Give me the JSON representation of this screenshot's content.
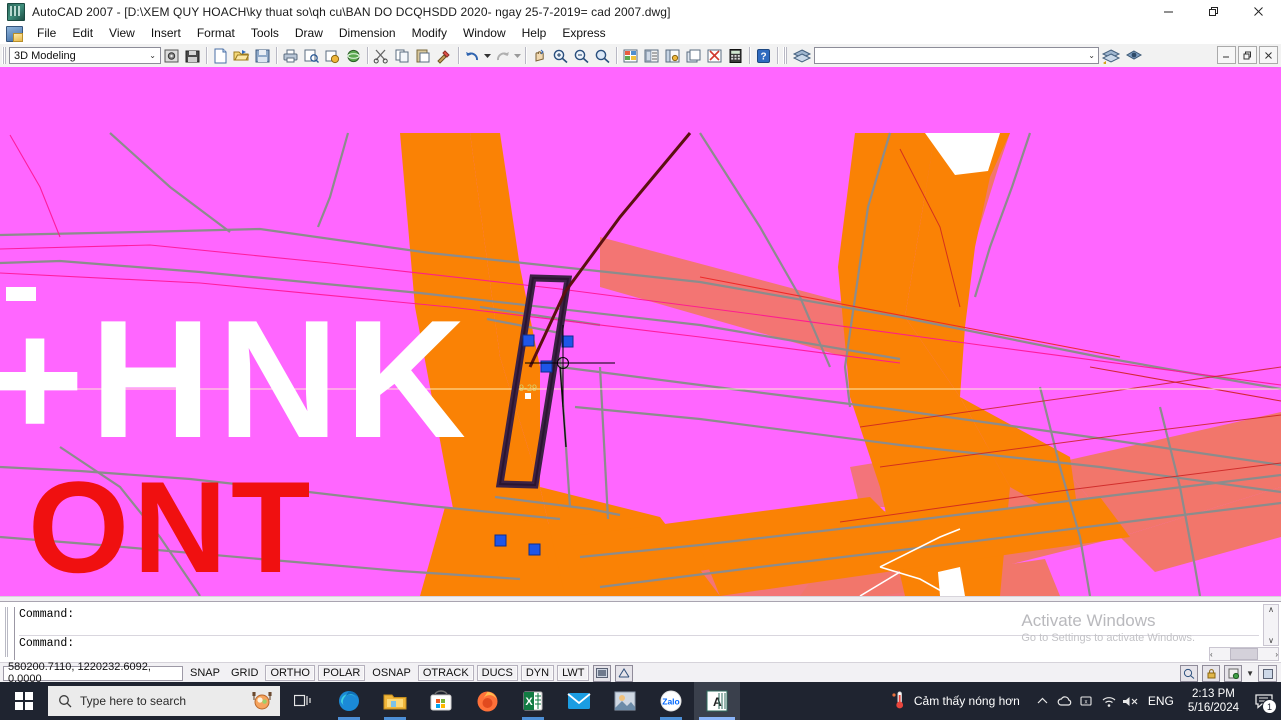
{
  "window": {
    "title": "AutoCAD 2007 - [D:\\XEM QUY HOACH\\ky thuat so\\qh cu\\BAN DO DCQHSDD 2020- ngay 25-7-2019= cad 2007.dwg]",
    "app_icon": "autocad-icon",
    "minimize": "—",
    "restore": "❐",
    "close": "✕",
    "doc_minimize": "—",
    "doc_restore": "❐",
    "doc_close": "✕"
  },
  "menu": {
    "items": [
      {
        "label": "File"
      },
      {
        "label": "Edit"
      },
      {
        "label": "View"
      },
      {
        "label": "Insert"
      },
      {
        "label": "Format"
      },
      {
        "label": "Tools"
      },
      {
        "label": "Draw"
      },
      {
        "label": "Dimension"
      },
      {
        "label": "Modify"
      },
      {
        "label": "Window"
      },
      {
        "label": "Help"
      },
      {
        "label": "Express"
      }
    ]
  },
  "toolbar": {
    "workspace_value": "3D Modeling",
    "workspace_chevron": "⌄",
    "layer_value": "",
    "layer_chevron": "⌄",
    "buttons": [
      {
        "name": "workspace-settings-icon",
        "tip": "Workspace Settings"
      },
      {
        "name": "workspace-save-icon",
        "tip": "Save Workspace"
      },
      {
        "name": "new-icon",
        "tip": "QNew"
      },
      {
        "name": "open-icon",
        "tip": "Open"
      },
      {
        "name": "save-icon",
        "tip": "Save"
      },
      {
        "name": "plot-icon",
        "tip": "Plot"
      },
      {
        "name": "plot-preview-icon",
        "tip": "Plot Preview"
      },
      {
        "name": "publish-icon",
        "tip": "Publish"
      },
      {
        "name": "3dorbit-icon",
        "tip": "3D Orbit"
      },
      {
        "name": "cut-icon",
        "tip": "Cut"
      },
      {
        "name": "copy-icon",
        "tip": "Copy"
      },
      {
        "name": "paste-icon",
        "tip": "Paste"
      },
      {
        "name": "match-properties-icon",
        "tip": "Match Properties"
      },
      {
        "name": "undo-icon",
        "tip": "Undo"
      },
      {
        "name": "redo-icon",
        "tip": "Redo"
      },
      {
        "name": "pan-icon",
        "tip": "Pan Realtime"
      },
      {
        "name": "zoom-realtime-icon",
        "tip": "Zoom Realtime"
      },
      {
        "name": "zoom-window-icon",
        "tip": "Zoom Window"
      },
      {
        "name": "zoom-previous-icon",
        "tip": "Zoom Previous"
      },
      {
        "name": "properties-icon",
        "tip": "Properties"
      },
      {
        "name": "designcenter-icon",
        "tip": "DesignCenter"
      },
      {
        "name": "tool-palettes-icon",
        "tip": "Tool Palettes"
      },
      {
        "name": "sheet-set-icon",
        "tip": "Sheet Set Manager"
      },
      {
        "name": "markup-set-icon",
        "tip": "Markup Set Manager"
      },
      {
        "name": "quickcalc-icon",
        "tip": "QuickCalc"
      },
      {
        "name": "help-icon",
        "tip": "Help"
      },
      {
        "name": "layer-manager-icon",
        "tip": "Layer Properties Manager"
      },
      {
        "name": "layer-previous-icon",
        "tip": "Layer Previous"
      },
      {
        "name": "layer-state-icon",
        "tip": "Layer States"
      }
    ]
  },
  "drawing": {
    "labels": [
      {
        "text": "+HNK",
        "color": "#ffffff"
      },
      {
        "text": "ONT",
        "color": "#f01010"
      },
      {
        "text": "9-29",
        "color": "#d9d06a"
      }
    ],
    "colors": {
      "background": "#ff66ff",
      "road": "#fa8205",
      "parcel": "#f2766b",
      "boundary": "#8c8c8c",
      "selection": "#3c2244",
      "grip": "#1e56e8",
      "crosshair": "#000000"
    },
    "selected_grips": 5
  },
  "command": {
    "line1": "Command:",
    "line2": "Command:",
    "scroll_up": "∧",
    "scroll_down": "∨",
    "hscroll_left": "‹",
    "hscroll_right": "›"
  },
  "watermark": {
    "line1": "Activate Windows",
    "line2": "Go to Settings to activate Windows."
  },
  "status": {
    "coordinates": "580200.7110, 1220232.6092, 0.0000",
    "toggles": [
      {
        "label": "SNAP",
        "framed": false
      },
      {
        "label": "GRID",
        "framed": false
      },
      {
        "label": "ORTHO",
        "framed": true
      },
      {
        "label": "POLAR",
        "framed": true
      },
      {
        "label": "OSNAP",
        "framed": false
      },
      {
        "label": "OTRACK",
        "framed": true
      },
      {
        "label": "DUCS",
        "framed": true
      },
      {
        "label": "DYN",
        "framed": true
      },
      {
        "label": "LWT",
        "framed": true
      }
    ],
    "icons": [
      {
        "name": "model-paper-icon"
      },
      {
        "name": "annotation-scale-icon"
      }
    ],
    "right_icons": [
      {
        "name": "comm-center-icon"
      },
      {
        "name": "lock-toolbars-icon"
      },
      {
        "name": "clean-screen-icon"
      },
      {
        "name": "status-menu-chevron-icon"
      }
    ],
    "maximize_icon": "❐"
  },
  "taskbar": {
    "start": "windows-logo-icon",
    "search_placeholder": "Type here to search",
    "search_icon": "search-icon",
    "food_icon": "food-doodle-icon",
    "task_view_icon": "task-view-icon",
    "apps": [
      {
        "name": "edge-icon",
        "label": "Microsoft Edge",
        "state": "open"
      },
      {
        "name": "file-explorer-icon",
        "label": "File Explorer",
        "state": "open"
      },
      {
        "name": "microsoft-store-icon",
        "label": "Microsoft Store",
        "state": "idle"
      },
      {
        "name": "firefox-icon",
        "label": "Firefox",
        "state": "idle"
      },
      {
        "name": "excel-icon",
        "label": "Excel",
        "state": "open"
      },
      {
        "name": "mail-icon",
        "label": "Mail",
        "state": "idle"
      },
      {
        "name": "photos-icon",
        "label": "Photos",
        "state": "idle"
      },
      {
        "name": "zalo-icon",
        "label": "Zalo",
        "state": "open"
      },
      {
        "name": "autocad-taskbar-icon",
        "label": "AutoCAD 2007",
        "state": "active"
      }
    ],
    "tray": {
      "weather_icon": "thermometer-icon",
      "weather_text": "Cảm thấy nóng hơn",
      "chevron": "∧",
      "icons": [
        {
          "name": "onedrive-icon"
        },
        {
          "name": "device-icon"
        },
        {
          "name": "wifi-icon"
        },
        {
          "name": "volume-muted-icon"
        }
      ],
      "language": "ENG",
      "time": "2:13 PM",
      "date": "5/16/2024",
      "notification_icon": "notification-icon",
      "notification_count": "1"
    }
  }
}
